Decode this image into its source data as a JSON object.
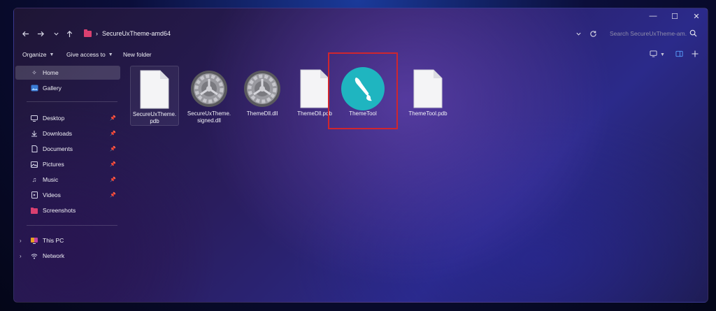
{
  "window": {
    "controls": {
      "minimize": "—",
      "maximize": "☐",
      "close": "✕"
    }
  },
  "address": {
    "breadcrumb_sep": "›",
    "current_folder": "SecureUxTheme-amd64",
    "search_placeholder": "Search SecureUxTheme-am..."
  },
  "toolbar": {
    "organize": "Organize",
    "give_access": "Give access to",
    "new_folder": "New folder"
  },
  "sidebar": {
    "quick": [
      {
        "label": "Home",
        "icon": "home-icon"
      },
      {
        "label": "Gallery",
        "icon": "gallery-icon"
      }
    ],
    "pinned": [
      {
        "label": "Desktop",
        "icon": "desktop-icon"
      },
      {
        "label": "Downloads",
        "icon": "download-icon"
      },
      {
        "label": "Documents",
        "icon": "document-icon"
      },
      {
        "label": "Pictures",
        "icon": "picture-icon"
      },
      {
        "label": "Music",
        "icon": "music-icon"
      },
      {
        "label": "Videos",
        "icon": "video-icon"
      },
      {
        "label": "Screenshots",
        "icon": "screenshot-folder-icon"
      }
    ],
    "locations": [
      {
        "label": "This PC",
        "icon": "pc-icon"
      },
      {
        "label": "Network",
        "icon": "network-icon"
      }
    ]
  },
  "files": [
    {
      "name": "SecureUxTheme.\npdb",
      "type": "blank-file-icon"
    },
    {
      "name": "SecureUxTheme.\nsigned.dll",
      "type": "gear-file-icon"
    },
    {
      "name": "ThemeDll.dll",
      "type": "gear-file-icon"
    },
    {
      "name": "ThemeDll.pdb",
      "type": "blank-file-icon"
    },
    {
      "name": "ThemeTool",
      "type": "paintbrush-app-icon"
    },
    {
      "name": "ThemeTool.pdb",
      "type": "blank-file-icon"
    }
  ],
  "colors": {
    "highlight_border": "#d0262e",
    "app_icon_bg": "#1fb5c0",
    "folder_accent": "#d94070"
  }
}
